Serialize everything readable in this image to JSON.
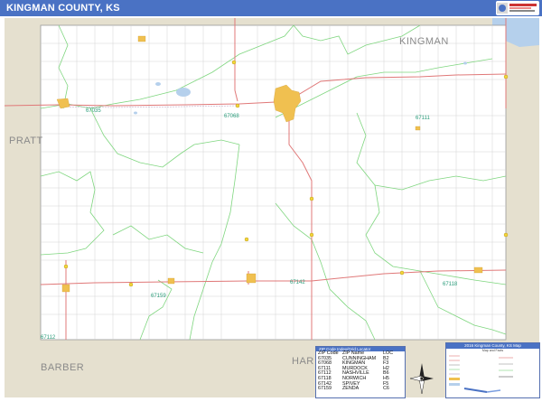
{
  "header": {
    "title": "KINGMAN COUNTY, KS",
    "title_bg": "#4a72c4"
  },
  "logo": {
    "icon": "map-publisher-logo"
  },
  "map": {
    "county_labels": {
      "kingman": "KINGMAN",
      "pratt": "PRATT",
      "barber": "BARBER",
      "harper_partial": "HAR"
    },
    "zip_labels": {
      "z67035": "67035",
      "z67068": "67068",
      "z67111": "67111",
      "z67142": "67142",
      "z67118": "67118",
      "z67159": "67159",
      "z67112": "67112"
    },
    "colors": {
      "outside": "#e5e0cf",
      "county_fill": "#ffffff",
      "zip_boundary": "#7fd67f",
      "highway": "#e07878",
      "road": "#cccccc",
      "city": "#f0c050",
      "water": "#b5d0ec"
    }
  },
  "zip_table": {
    "header": "ZIP Code Index/Grid Locator",
    "columns": [
      "ZIP Code",
      "ZIP Name",
      "LOC"
    ],
    "rows": [
      [
        "67035",
        "CUNNINGHAM",
        "B2"
      ],
      [
        "67068",
        "KINGMAN",
        "F3"
      ],
      [
        "67111",
        "MURDOCK",
        "H2"
      ],
      [
        "67112",
        "NASHVILLE",
        "B6"
      ],
      [
        "67118",
        "NORWICH",
        "H5"
      ],
      [
        "67142",
        "SPIVEY",
        "F5"
      ],
      [
        "67159",
        "ZENDA",
        "C6"
      ]
    ]
  },
  "legend": {
    "header": "2016 Kingman County, KS Map",
    "subheader": "Map and Facts"
  }
}
